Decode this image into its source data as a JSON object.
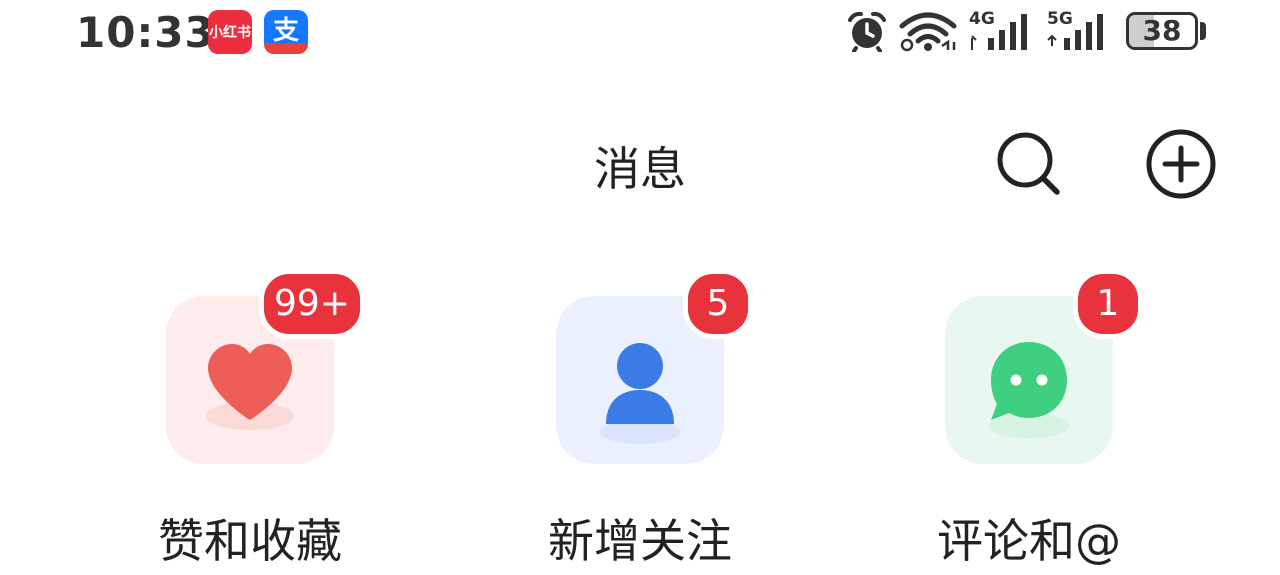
{
  "status_bar": {
    "time": "10:33",
    "app_icons": [
      {
        "name": "xiaohongshu",
        "text": "小红书",
        "color": "#ee2e3e"
      },
      {
        "name": "alipay",
        "glyph": "支",
        "color": "#1677ff"
      }
    ],
    "network_1": "4G",
    "network_2": "5G",
    "battery_level": "38",
    "icons": [
      "alarm-icon",
      "wifi-icon",
      "signal-icon",
      "signal-icon",
      "battery-icon"
    ]
  },
  "header": {
    "title": "消息",
    "actions": [
      "search-icon",
      "add-circle-icon"
    ]
  },
  "categories": [
    {
      "label": "赞和收藏",
      "badge": "99+",
      "icon": "heart-icon",
      "color": "#ee5d58"
    },
    {
      "label": "新增关注",
      "badge": "5",
      "icon": "person-icon",
      "color": "#3a7be6"
    },
    {
      "label": "评论和@",
      "badge": "1",
      "icon": "chat-bubble-icon",
      "color": "#3fcf80"
    }
  ],
  "colors": {
    "badge": "#e8323c",
    "text": "#222222"
  }
}
